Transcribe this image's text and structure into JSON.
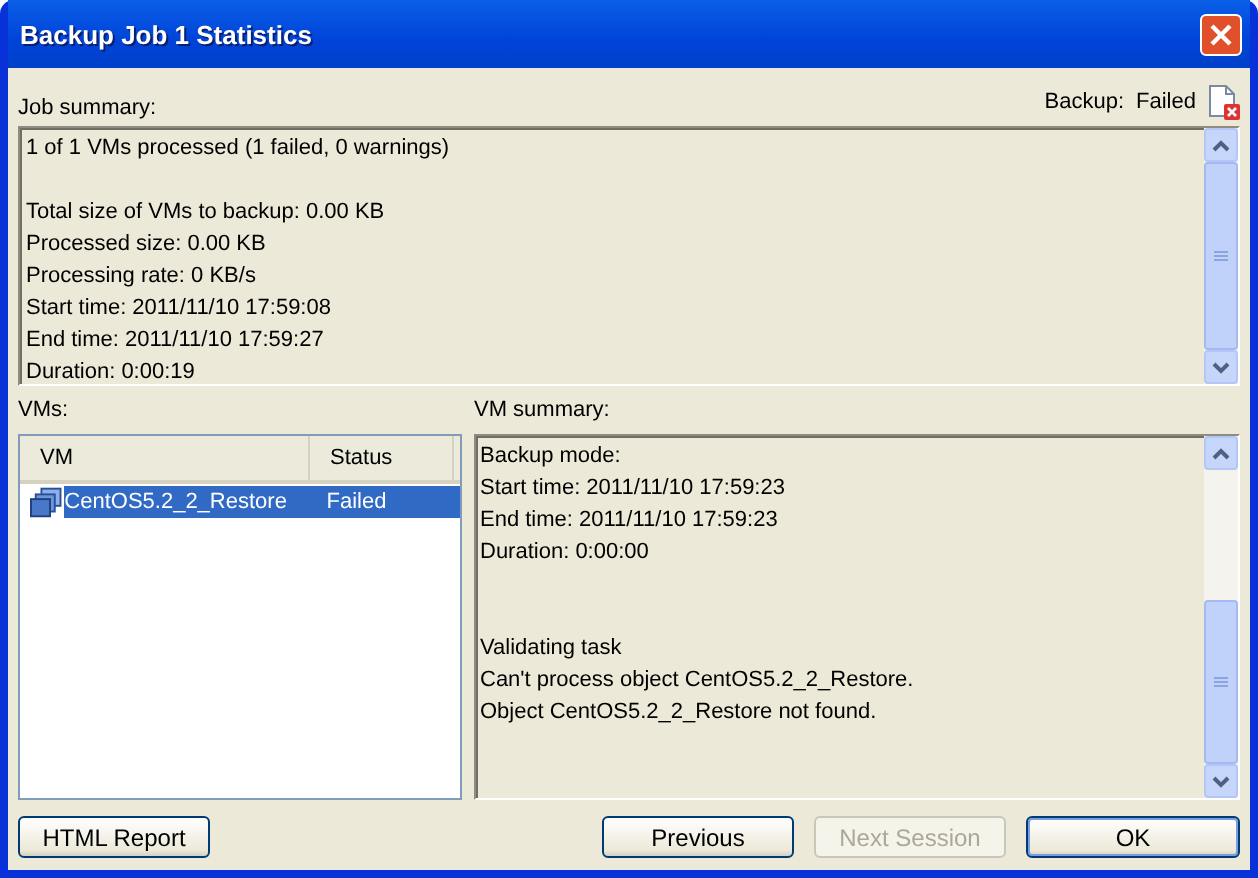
{
  "window": {
    "title": "Backup Job 1 Statistics"
  },
  "job_summary": {
    "label": "Job summary:",
    "status_label": "Backup:",
    "status_value": "Failed",
    "paragraphs": [
      [
        "1 of 1 VMs processed (1 failed, 0 warnings)"
      ],
      [
        "Total size of VMs to backup: 0.00 KB",
        "Processed size: 0.00 KB",
        "Processing rate: 0 KB/s",
        "Start time: 2011/11/10 17:59:08",
        "End time: 2011/11/10 17:59:27",
        "Duration: 0:00:19"
      ]
    ]
  },
  "vms": {
    "label": "VMs:",
    "columns": [
      "VM",
      "Status"
    ],
    "rows": [
      {
        "name": "CentOS5.2_2_Restore",
        "status": "Failed",
        "selected": true
      }
    ]
  },
  "vm_summary": {
    "label": "VM summary:",
    "paragraphs": [
      [
        "Backup mode:",
        "Start time: 2011/11/10 17:59:23",
        "End time: 2011/11/10 17:59:23",
        "Duration: 0:00:00"
      ],
      [
        "Validating task",
        "Can't process object CentOS5.2_2_Restore.",
        "Object CentOS5.2_2_Restore not found."
      ]
    ]
  },
  "left_buttons": [
    {
      "label": "HTML Report",
      "disabled": false,
      "default": false
    }
  ],
  "right_buttons": [
    {
      "label": "Previous",
      "disabled": false,
      "default": false
    },
    {
      "label": "Next Session",
      "disabled": true,
      "default": false
    },
    {
      "label": "OK",
      "disabled": false,
      "default": true
    }
  ]
}
